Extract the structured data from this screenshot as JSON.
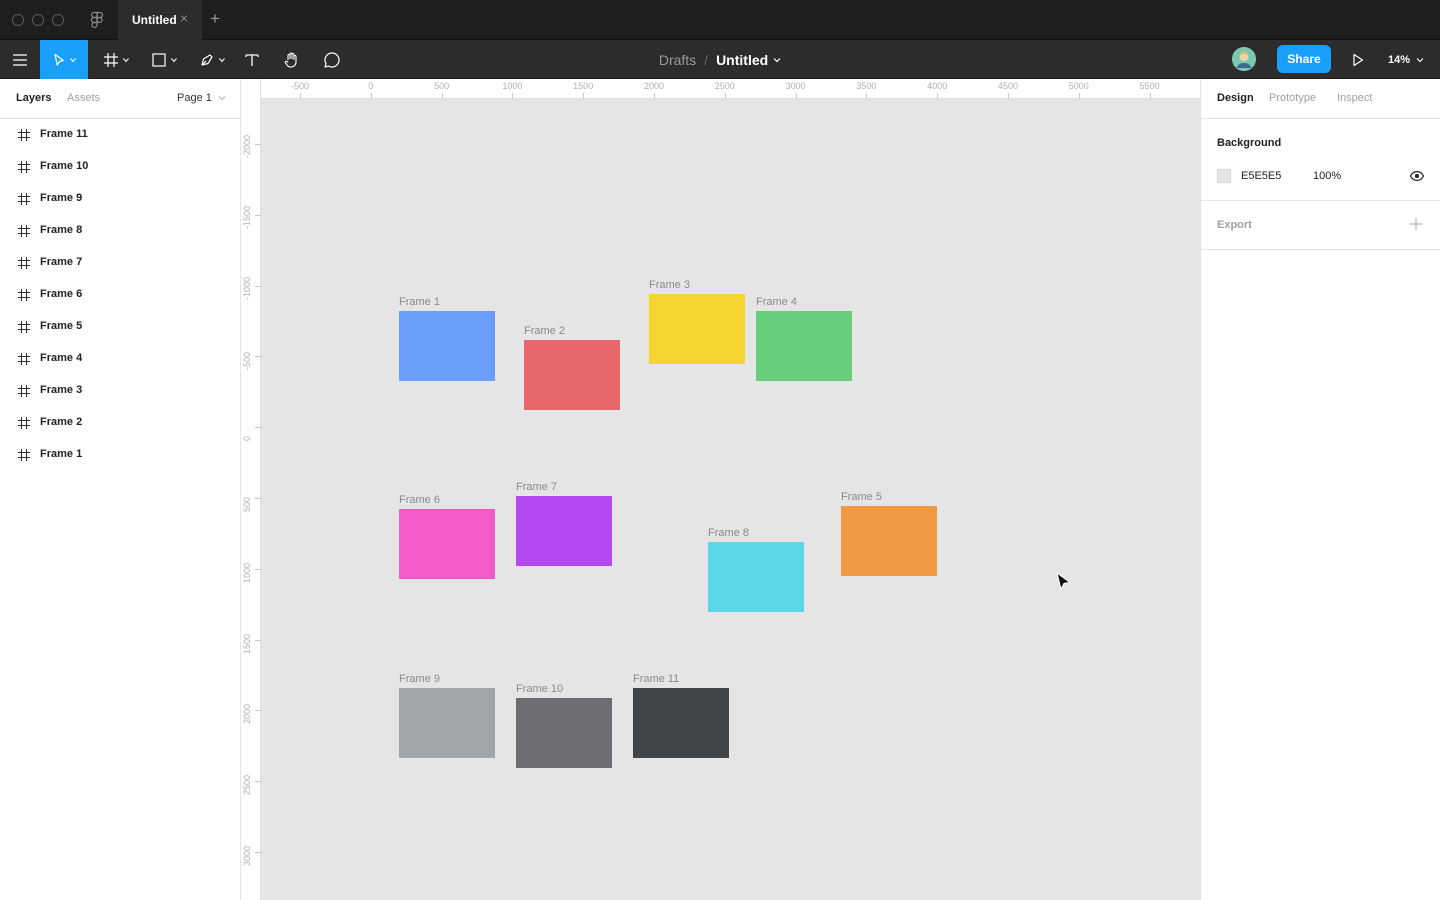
{
  "titlebar": {
    "tab_title": "Untitled",
    "tab_close": "×",
    "new_tab": "+"
  },
  "toolbar": {
    "breadcrumb_drafts": "Drafts",
    "breadcrumb_sep": "/",
    "file_name": "Untitled",
    "share_label": "Share",
    "zoom": "14%"
  },
  "left_panel": {
    "tab_layers": "Layers",
    "tab_assets": "Assets",
    "page": "Page 1",
    "layers": [
      "Frame 11",
      "Frame 10",
      "Frame 9",
      "Frame 8",
      "Frame 7",
      "Frame 6",
      "Frame 5",
      "Frame 4",
      "Frame 3",
      "Frame 2",
      "Frame 1"
    ]
  },
  "rulers": {
    "top": [
      "-500",
      "0",
      "500",
      "1000",
      "1500",
      "2000",
      "2500",
      "3000",
      "3500",
      "4000",
      "4500",
      "5000",
      "5500"
    ],
    "left": [
      "-2000",
      "-1500",
      "-1000",
      "-500",
      "0",
      "500",
      "1000",
      "1500",
      "2000",
      "2500",
      "3000"
    ]
  },
  "frames": [
    {
      "name": "Frame 1",
      "color": "#6b9ef8"
    },
    {
      "name": "Frame 2",
      "color": "#e8676a"
    },
    {
      "name": "Frame 3",
      "color": "#f6d530"
    },
    {
      "name": "Frame 4",
      "color": "#67ce7b"
    },
    {
      "name": "Frame 5",
      "color": "#f29a43"
    },
    {
      "name": "Frame 6",
      "color": "#f25bc8"
    },
    {
      "name": "Frame 7",
      "color": "#b54af0"
    },
    {
      "name": "Frame 8",
      "color": "#5bd8e8"
    },
    {
      "name": "Frame 9",
      "color": "#a3a6a9"
    },
    {
      "name": "Frame 10",
      "color": "#6c6e71"
    },
    {
      "name": "Frame 11",
      "color": "#414448"
    }
  ],
  "help_label": "?",
  "right_panel": {
    "tab_design": "Design",
    "tab_prototype": "Prototype",
    "tab_inspect": "Inspect",
    "background_title": "Background",
    "background_hex": "E5E5E5",
    "background_opacity": "100%",
    "export_title": "Export"
  }
}
